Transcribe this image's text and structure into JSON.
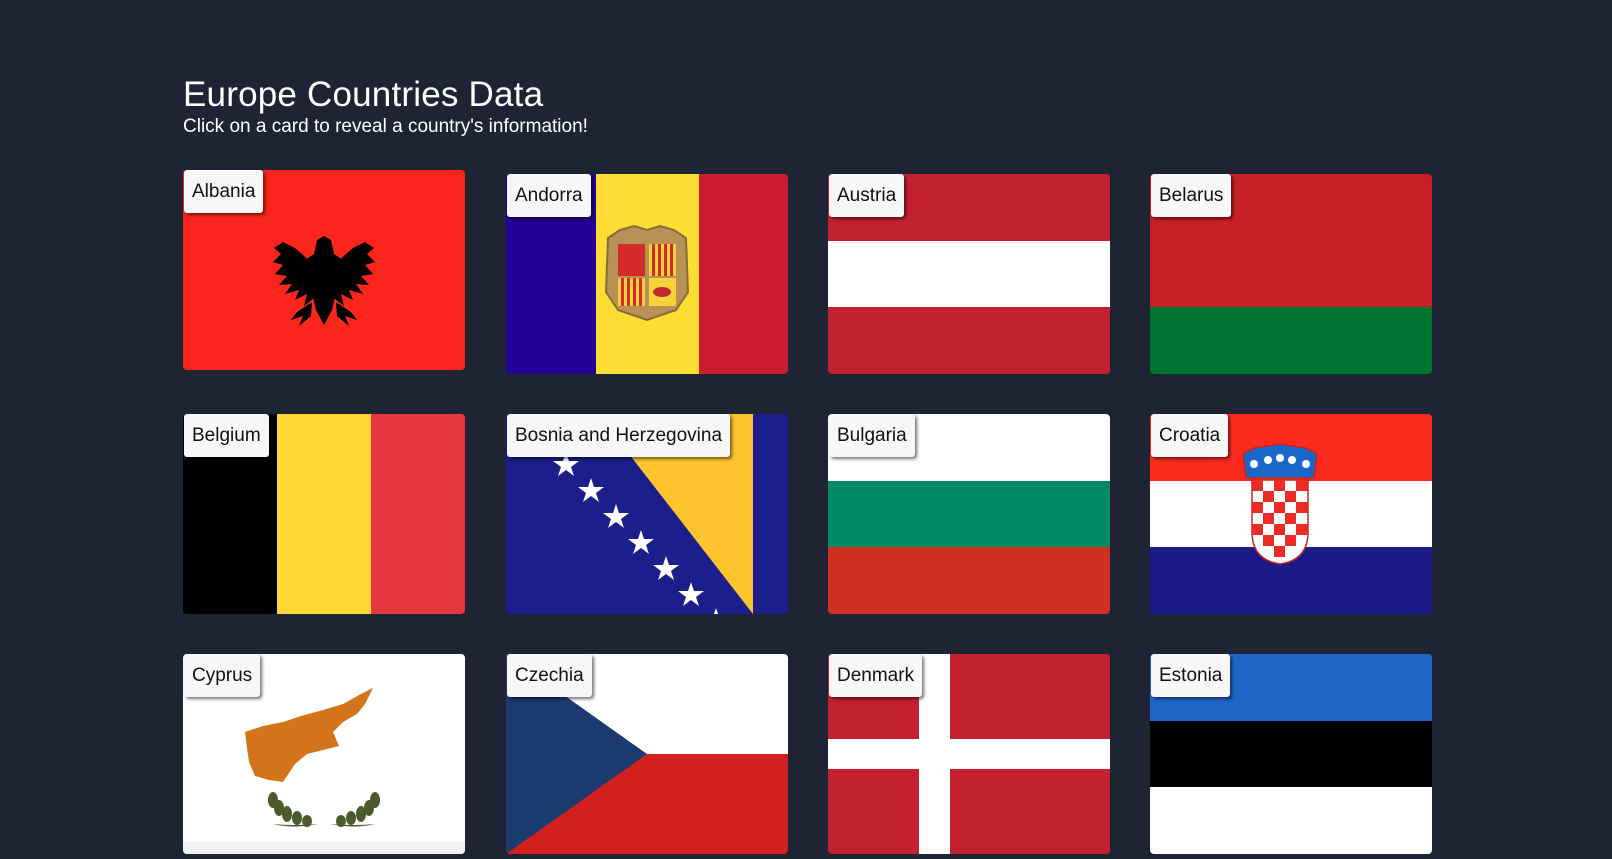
{
  "header": {
    "title": "Europe Countries Data",
    "subtitle": "Click on a card to reveal a country's information!"
  },
  "countries": [
    {
      "name": "Albania",
      "flag_icon": "albania-flag-icon",
      "colors": [
        "#fa261d",
        "#000000"
      ]
    },
    {
      "name": "Andorra",
      "flag_icon": "andorra-flag-icon",
      "colors": [
        "#240094",
        "#fbdd33",
        "#cc1c31"
      ]
    },
    {
      "name": "Austria",
      "flag_icon": "austria-flag-icon",
      "colors": [
        "#c32130",
        "#ffffff"
      ]
    },
    {
      "name": "Belarus",
      "flag_icon": "belarus-flag-icon",
      "colors": [
        "#c62026",
        "#007532"
      ]
    },
    {
      "name": "Belgium",
      "flag_icon": "belgium-flag-icon",
      "colors": [
        "#000000",
        "#fad737",
        "#e6393f"
      ]
    },
    {
      "name": "Bosnia and Herzegovina",
      "flag_icon": "bosnia-flag-icon",
      "colors": [
        "#1b1e8b",
        "#fdc42e",
        "#ffffff"
      ]
    },
    {
      "name": "Bulgaria",
      "flag_icon": "bulgaria-flag-icon",
      "colors": [
        "#ffffff",
        "#008a66",
        "#d0301f"
      ]
    },
    {
      "name": "Croatia",
      "flag_icon": "croatia-flag-icon",
      "colors": [
        "#fa2a1f",
        "#ffffff",
        "#1b1888"
      ]
    },
    {
      "name": "Cyprus",
      "flag_icon": "cyprus-flag-icon",
      "colors": [
        "#ffffff",
        "#d3741b",
        "#4c5a2c"
      ]
    },
    {
      "name": "Czechia",
      "flag_icon": "czechia-flag-icon",
      "colors": [
        "#ffffff",
        "#d1201d",
        "#1b3b6f"
      ]
    },
    {
      "name": "Denmark",
      "flag_icon": "denmark-flag-icon",
      "colors": [
        "#c32130",
        "#ffffff"
      ]
    },
    {
      "name": "Estonia",
      "flag_icon": "estonia-flag-icon",
      "colors": [
        "#2164c8",
        "#000000",
        "#ffffff"
      ]
    }
  ]
}
